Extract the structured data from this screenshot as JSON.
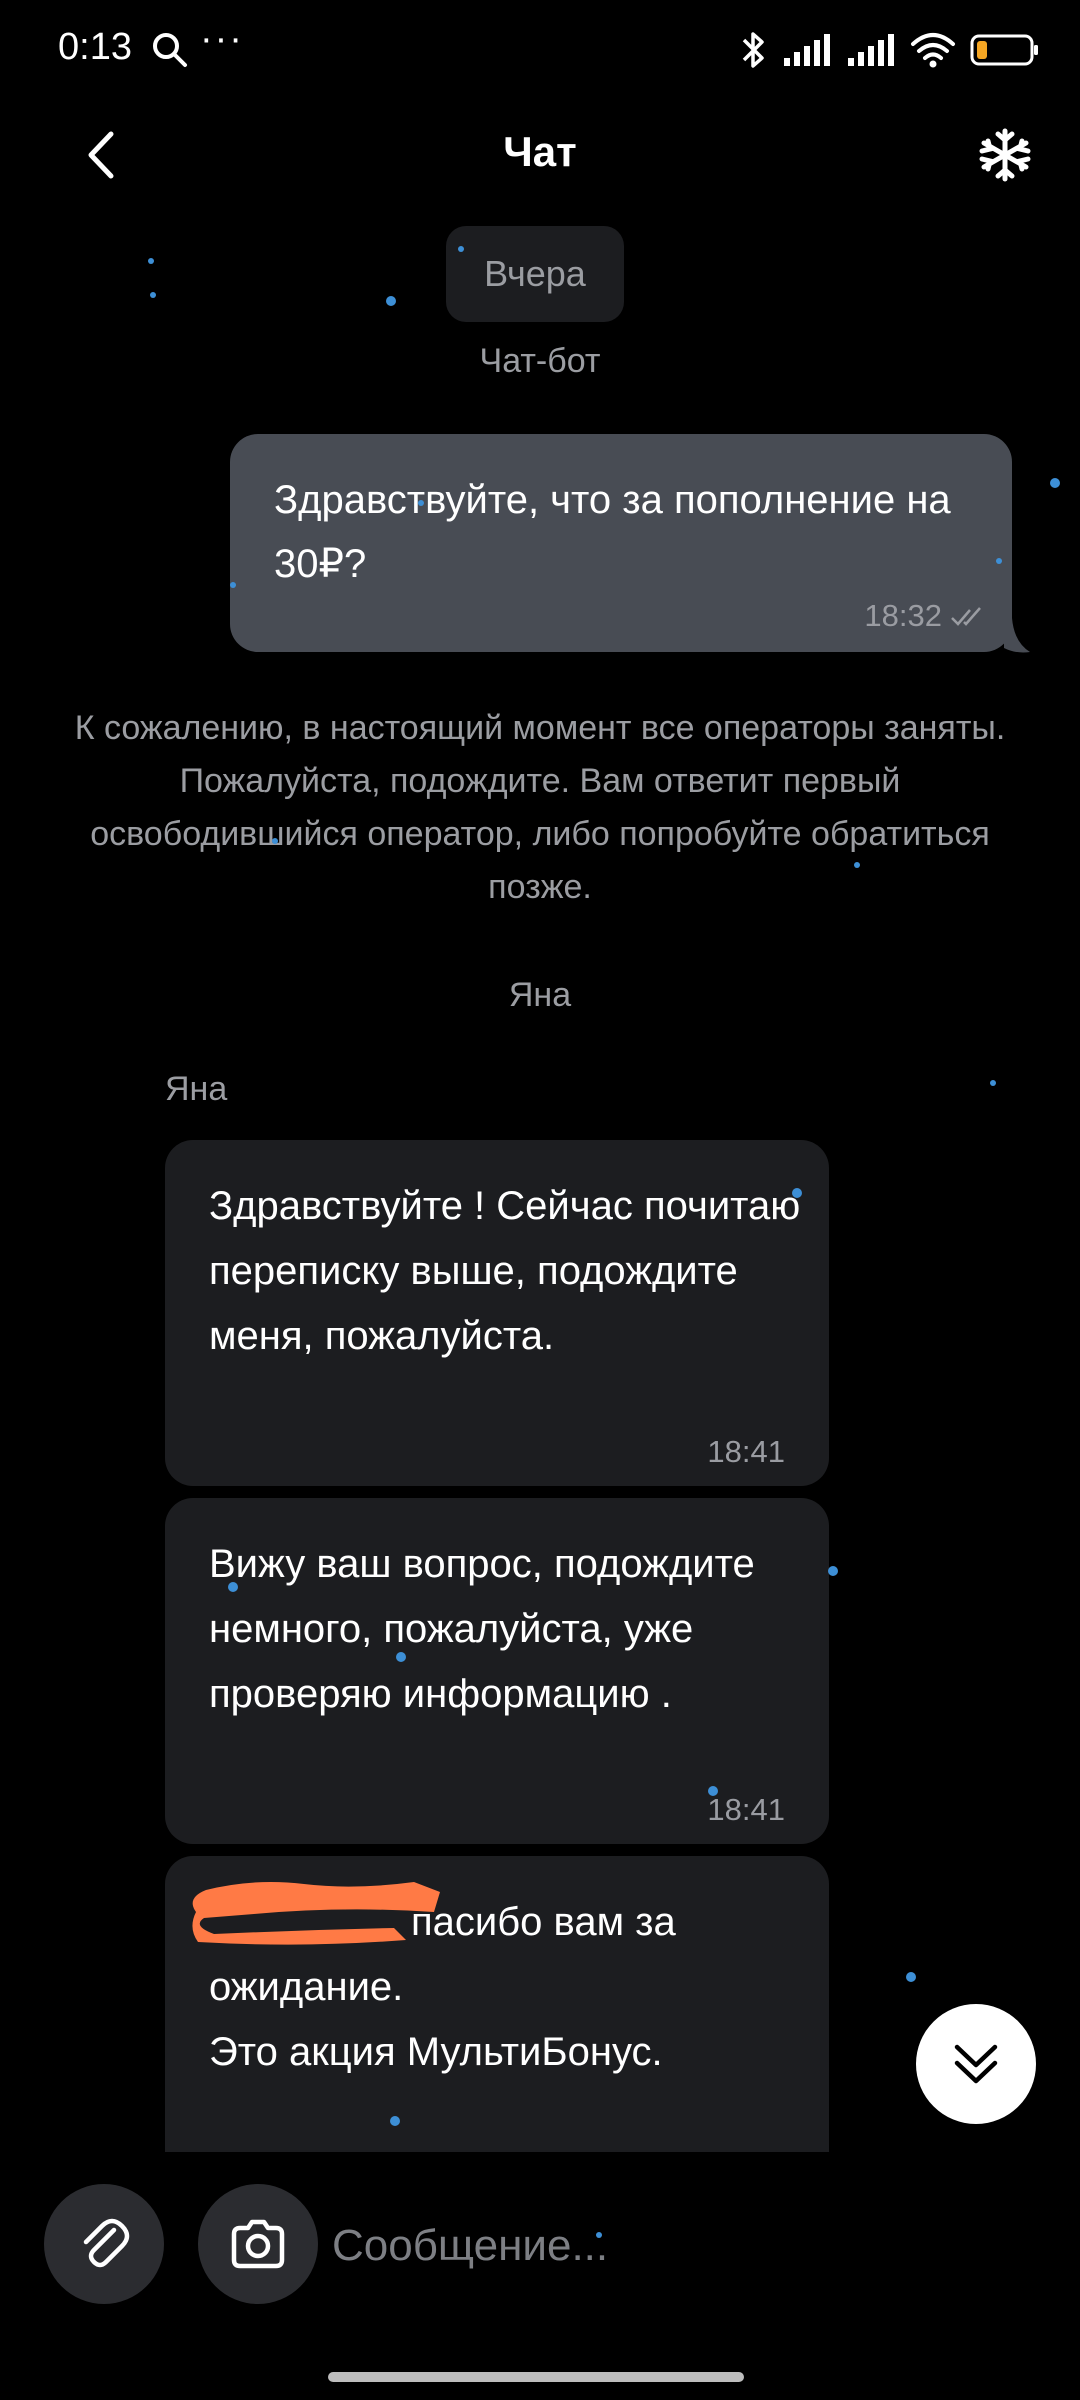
{
  "status_bar": {
    "time": "0:13",
    "more": "···",
    "battery_level": 0.2
  },
  "header": {
    "title": "Чат"
  },
  "chat": {
    "date_chip": "Вчера",
    "bot_label": "Чат-бот",
    "outgoing": {
      "text": "Здравствуйте, что за пополнение на 30₽?",
      "time": "18:32"
    },
    "system_message": "К сожалению, в настоящий момент все операторы заняты. Пожалуйста, подождите. Вам ответит первый освободившийся оператор, либо попробуйте обратиться позже.",
    "operator_joined": "Яна",
    "sender_name": "Яна",
    "incoming": [
      {
        "text": "Здравствуйте ! Сейчас почитаю переписку выше, подождите меня, пожалуйста.",
        "time": "18:41"
      },
      {
        "text": "Вижу ваш вопрос, подождите немного, пожалуйста, уже проверяю информацию .",
        "time": "18:41"
      },
      {
        "text": "пасибо вам за ожидание.\nЭто акция МультиБонус."
      }
    ]
  },
  "input": {
    "placeholder": "Сообщение..."
  },
  "colors": {
    "background": "#000000",
    "bubble_out": "#484c54",
    "bubble_in": "#1c1d20",
    "muted_text": "#9b9da2",
    "redaction": "#ff7a45"
  }
}
